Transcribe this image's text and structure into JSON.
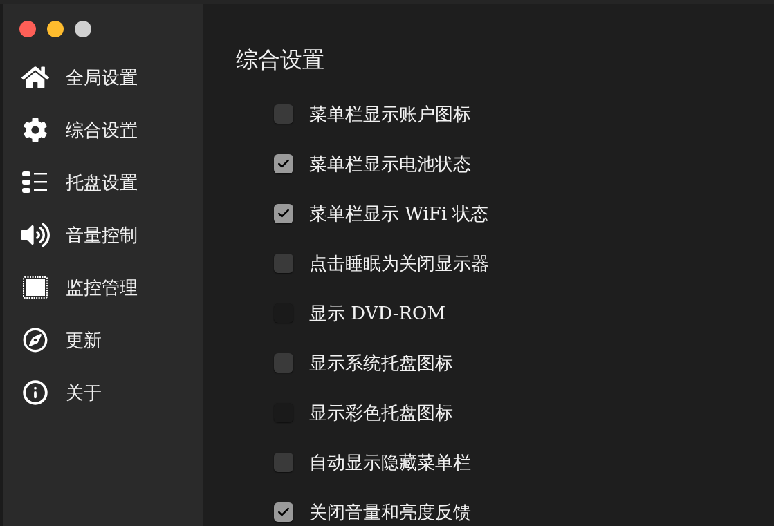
{
  "sidebar": {
    "items": [
      {
        "label": "全局设置"
      },
      {
        "label": "综合设置"
      },
      {
        "label": "托盘设置"
      },
      {
        "label": "音量控制"
      },
      {
        "label": "监控管理"
      },
      {
        "label": "更新"
      },
      {
        "label": "关于"
      }
    ]
  },
  "content": {
    "title": "综合设置",
    "options": [
      {
        "label": "菜单栏显示账户图标",
        "checked": false,
        "disabled": false
      },
      {
        "label": "菜单栏显示电池状态",
        "checked": true,
        "disabled": false
      },
      {
        "label": "菜单栏显示 WiFi 状态",
        "checked": true,
        "disabled": false
      },
      {
        "label": "点击睡眠为关闭显示器",
        "checked": false,
        "disabled": false
      },
      {
        "label": "显示 DVD-ROM",
        "checked": false,
        "disabled": true
      },
      {
        "label": "显示系统托盘图标",
        "checked": false,
        "disabled": false
      },
      {
        "label": "显示彩色托盘图标",
        "checked": false,
        "disabled": true
      },
      {
        "label": "自动显示隐藏菜单栏",
        "checked": false,
        "disabled": false
      },
      {
        "label": "关闭音量和亮度反馈",
        "checked": true,
        "disabled": false
      }
    ]
  }
}
